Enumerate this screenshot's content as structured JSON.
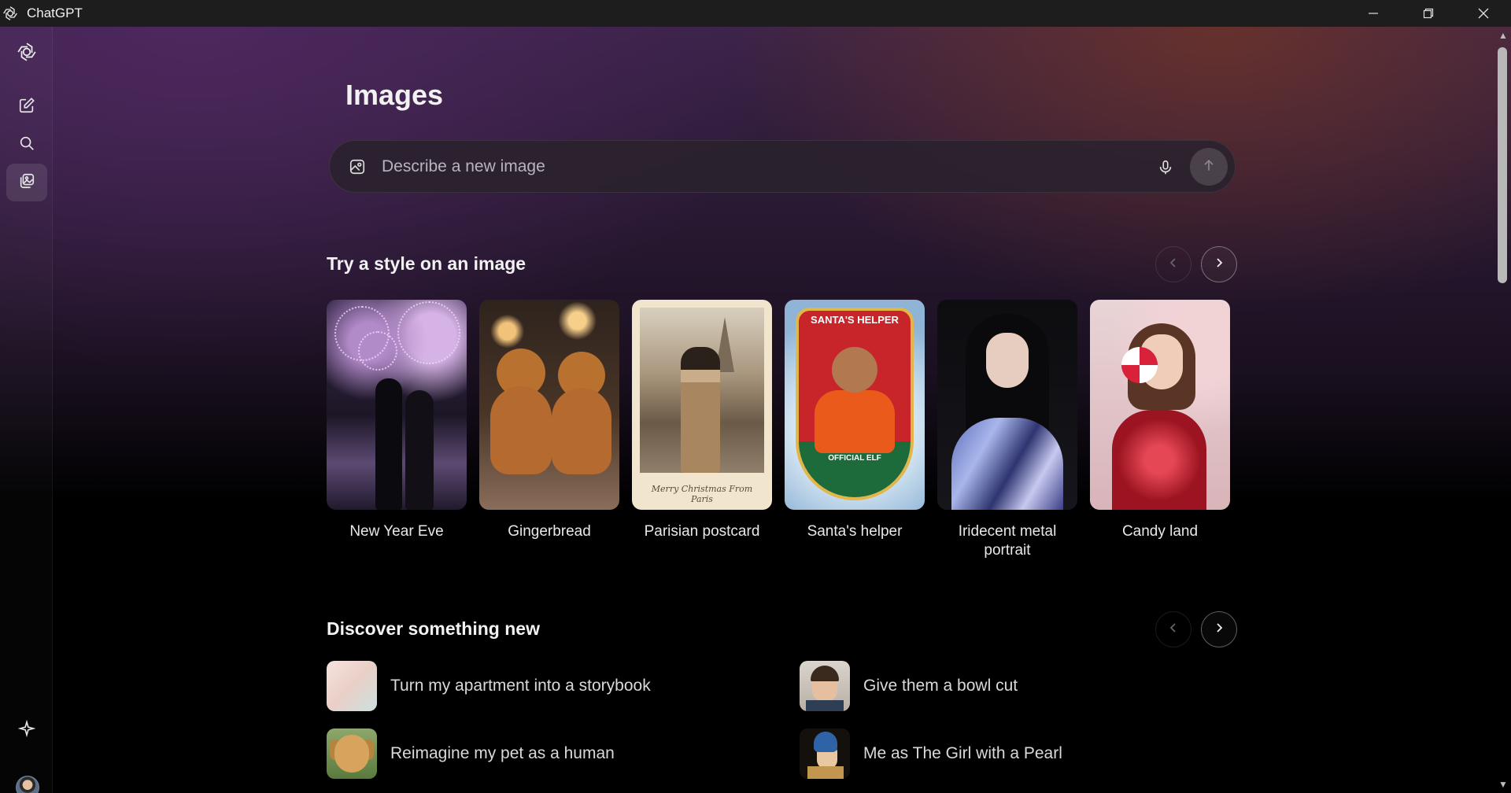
{
  "window": {
    "title": "ChatGPT",
    "controls": [
      "minimize",
      "restore",
      "close"
    ]
  },
  "sidebar": {
    "items": [
      {
        "icon": "openai-logo-icon"
      },
      {
        "icon": "new-chat-icon"
      },
      {
        "icon": "search-icon"
      },
      {
        "icon": "images-icon",
        "active": true
      }
    ],
    "bottom": [
      {
        "icon": "sparkle-icon"
      },
      {
        "icon": "avatar"
      }
    ]
  },
  "page": {
    "title": "Images"
  },
  "prompt": {
    "placeholder": "Describe a new image",
    "value": ""
  },
  "styles_section": {
    "title": "Try a style on an image",
    "cards": [
      {
        "label": "New Year Eve"
      },
      {
        "label": "Gingerbread"
      },
      {
        "label": "Parisian postcard",
        "caption": "Merry Christmas From Paris"
      },
      {
        "label": "Santa's helper",
        "banner": "SANTA'S HELPER",
        "badge": "OFFICIAL ELF"
      },
      {
        "label": "Iridecent metal portrait"
      },
      {
        "label": "Candy land"
      }
    ]
  },
  "discover_section": {
    "title": "Discover something new",
    "items": [
      {
        "label": "Turn my apartment into a storybook"
      },
      {
        "label": "Give them a bowl cut"
      },
      {
        "label": "Reimagine my pet as a human"
      },
      {
        "label": "Me as The Girl with a Pearl"
      }
    ]
  },
  "colors": {
    "accent_purple": "#3a2348",
    "accent_rust": "#6e3428",
    "text": "#ececec"
  }
}
